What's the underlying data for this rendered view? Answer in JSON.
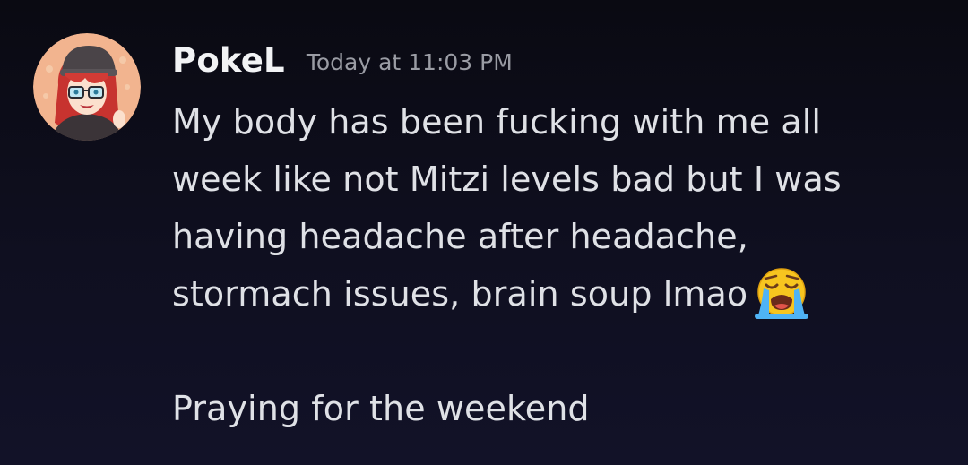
{
  "message": {
    "author": "PokeL",
    "timestamp": "Today at 11:03 PM",
    "lines": [
      "My body has been fucking with me all",
      "week like not Mitzi levels bad but I was",
      "having headache after headache,",
      "stormach issues, brain soup lmao"
    ],
    "emoji": "loudly-crying-face",
    "closing_line": "Praying for the weekend"
  },
  "colors": {
    "background": "#0f0f20",
    "username": "#f2f3f5",
    "timestamp": "#9a9ca4",
    "text": "#dfe1e6",
    "avatar_bg": "#f2b48f"
  }
}
